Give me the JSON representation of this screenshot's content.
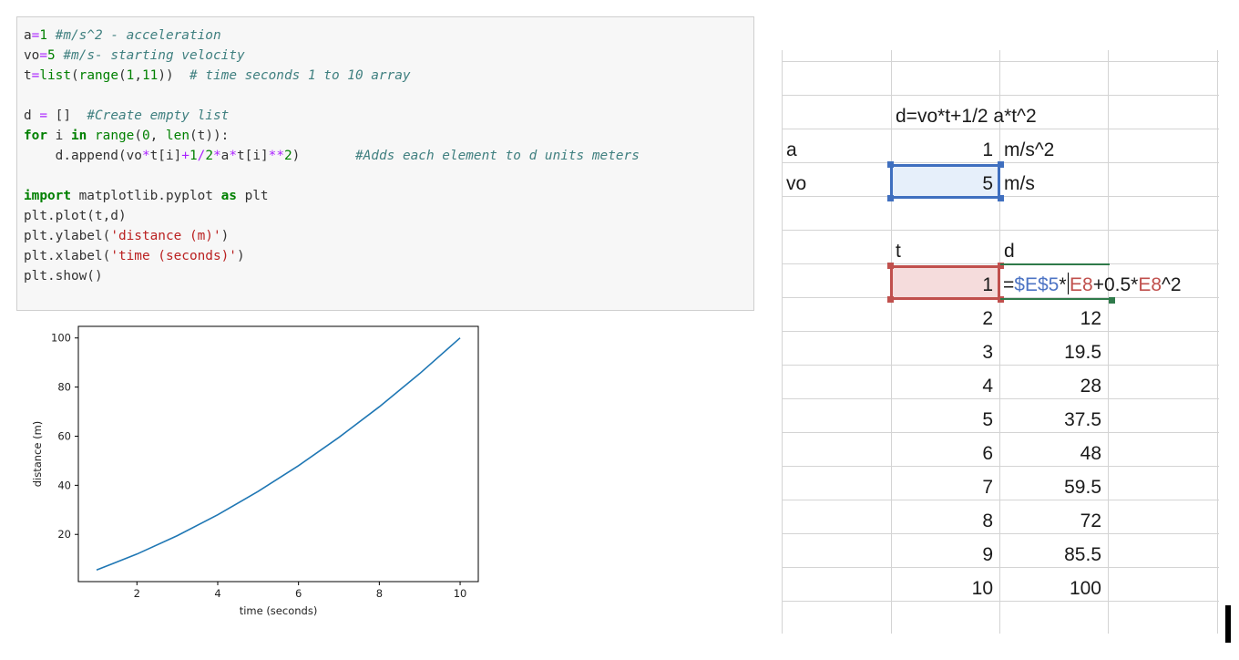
{
  "notebook": {
    "code_lines": [
      [
        {
          "t": "a",
          "c": ""
        },
        {
          "t": "=",
          "c": "op"
        },
        {
          "t": "1",
          "c": "num"
        },
        {
          "t": " #m/s^2 - acceleration",
          "c": "com"
        }
      ],
      [
        {
          "t": "vo",
          "c": ""
        },
        {
          "t": "=",
          "c": "op"
        },
        {
          "t": "5",
          "c": "num"
        },
        {
          "t": " #m/s- starting velocity",
          "c": "com"
        }
      ],
      [
        {
          "t": "t",
          "c": ""
        },
        {
          "t": "=",
          "c": "op"
        },
        {
          "t": "list",
          "c": "fn"
        },
        {
          "t": "(",
          "c": ""
        },
        {
          "t": "range",
          "c": "fn"
        },
        {
          "t": "(",
          "c": ""
        },
        {
          "t": "1",
          "c": "num"
        },
        {
          "t": ",",
          "c": ""
        },
        {
          "t": "11",
          "c": "num"
        },
        {
          "t": "))  ",
          "c": ""
        },
        {
          "t": "# time seconds 1 to 10 array",
          "c": "com"
        }
      ],
      [],
      [
        {
          "t": "d ",
          "c": ""
        },
        {
          "t": "=",
          "c": "op"
        },
        {
          "t": " []  ",
          "c": ""
        },
        {
          "t": "#Create empty list",
          "c": "com"
        }
      ],
      [
        {
          "t": "for",
          "c": "kw"
        },
        {
          "t": " i ",
          "c": ""
        },
        {
          "t": "in",
          "c": "kw"
        },
        {
          "t": " ",
          "c": ""
        },
        {
          "t": "range",
          "c": "fn"
        },
        {
          "t": "(",
          "c": ""
        },
        {
          "t": "0",
          "c": "num"
        },
        {
          "t": ", ",
          "c": ""
        },
        {
          "t": "len",
          "c": "fn"
        },
        {
          "t": "(t)):",
          "c": ""
        }
      ],
      [
        {
          "t": "    d.append(vo",
          "c": ""
        },
        {
          "t": "*",
          "c": "op"
        },
        {
          "t": "t[i]",
          "c": ""
        },
        {
          "t": "+",
          "c": "op"
        },
        {
          "t": "1",
          "c": "num"
        },
        {
          "t": "/",
          "c": "op"
        },
        {
          "t": "2",
          "c": "num"
        },
        {
          "t": "*",
          "c": "op"
        },
        {
          "t": "a",
          "c": ""
        },
        {
          "t": "*",
          "c": "op"
        },
        {
          "t": "t[i]",
          "c": ""
        },
        {
          "t": "**",
          "c": "op"
        },
        {
          "t": "2",
          "c": "num"
        },
        {
          "t": ")       ",
          "c": ""
        },
        {
          "t": "#Adds each element to d units meters",
          "c": "com"
        }
      ],
      [],
      [
        {
          "t": "import",
          "c": "kw"
        },
        {
          "t": " matplotlib.pyplot ",
          "c": ""
        },
        {
          "t": "as",
          "c": "kw"
        },
        {
          "t": " plt",
          "c": ""
        }
      ],
      [
        {
          "t": "plt.plot(t,d)",
          "c": ""
        }
      ],
      [
        {
          "t": "plt.ylabel(",
          "c": ""
        },
        {
          "t": "'distance (m)'",
          "c": "str"
        },
        {
          "t": ")",
          "c": ""
        }
      ],
      [
        {
          "t": "plt.xlabel(",
          "c": ""
        },
        {
          "t": "'time (seconds)'",
          "c": "str"
        },
        {
          "t": ")",
          "c": ""
        }
      ],
      [
        {
          "t": "plt.show()",
          "c": ""
        }
      ]
    ]
  },
  "chart_data": {
    "type": "line",
    "xlabel": "time (seconds)",
    "ylabel": "distance (m)",
    "x": [
      1,
      2,
      3,
      4,
      5,
      6,
      7,
      8,
      9,
      10
    ],
    "series": [
      {
        "values": [
          5.5,
          12,
          19.5,
          28,
          37.5,
          48,
          59.5,
          72,
          85.5,
          100
        ]
      }
    ],
    "xlim": [
      0.55,
      10.45
    ],
    "ylim": [
      0.78,
      104.73
    ],
    "xticks": [
      "2",
      "4",
      "6",
      "8",
      "10"
    ],
    "yticks": [
      "20",
      "40",
      "60",
      "80",
      "100"
    ],
    "grid": false,
    "line_color": "#1f77b4"
  },
  "spreadsheet": {
    "formula_label": "d=vo*t+1/2 a*t^2",
    "a_label": "a",
    "a_value": "1",
    "a_unit": "m/s^2",
    "vo_label": "vo",
    "vo_value": "5",
    "vo_unit": "m/s",
    "t_header": "t",
    "d_header": "d",
    "editing": {
      "prefix": "=",
      "ref1": "$E$5",
      "op1": "*",
      "ref2": "E8",
      "mid": "+0.5*",
      "ref3": "E8",
      "suffix": "^2"
    },
    "rows": [
      {
        "t": "1",
        "d": ""
      },
      {
        "t": "2",
        "d": "12"
      },
      {
        "t": "3",
        "d": "19.5"
      },
      {
        "t": "4",
        "d": "28"
      },
      {
        "t": "5",
        "d": "37.5"
      },
      {
        "t": "6",
        "d": "48"
      },
      {
        "t": "7",
        "d": "59.5"
      },
      {
        "t": "8",
        "d": "72"
      },
      {
        "t": "9",
        "d": "85.5"
      },
      {
        "t": "10",
        "d": "100"
      }
    ],
    "colors": {
      "ref_blue": "#3f6fbf",
      "ref_red": "#c0504d",
      "ref_green": "#2f7a4a"
    }
  }
}
